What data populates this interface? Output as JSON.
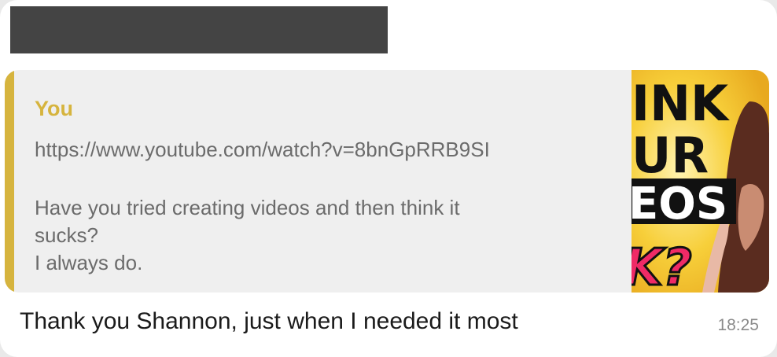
{
  "quoted_message": {
    "author": "You",
    "link": "https://www.youtube.com/watch?v=8bnGpRRB9SI",
    "lines": [
      "Have you tried creating videos and then think it",
      "sucks?",
      "I always do."
    ],
    "thumbnail_text": [
      "INK",
      "UR",
      "EOS",
      "K?"
    ]
  },
  "message": {
    "text": "Thank you Shannon, just when I needed it most",
    "time": "18:25"
  },
  "colors": {
    "quote_accent": "#d6b43e",
    "thumbnail_bg": "#f2c12b"
  }
}
